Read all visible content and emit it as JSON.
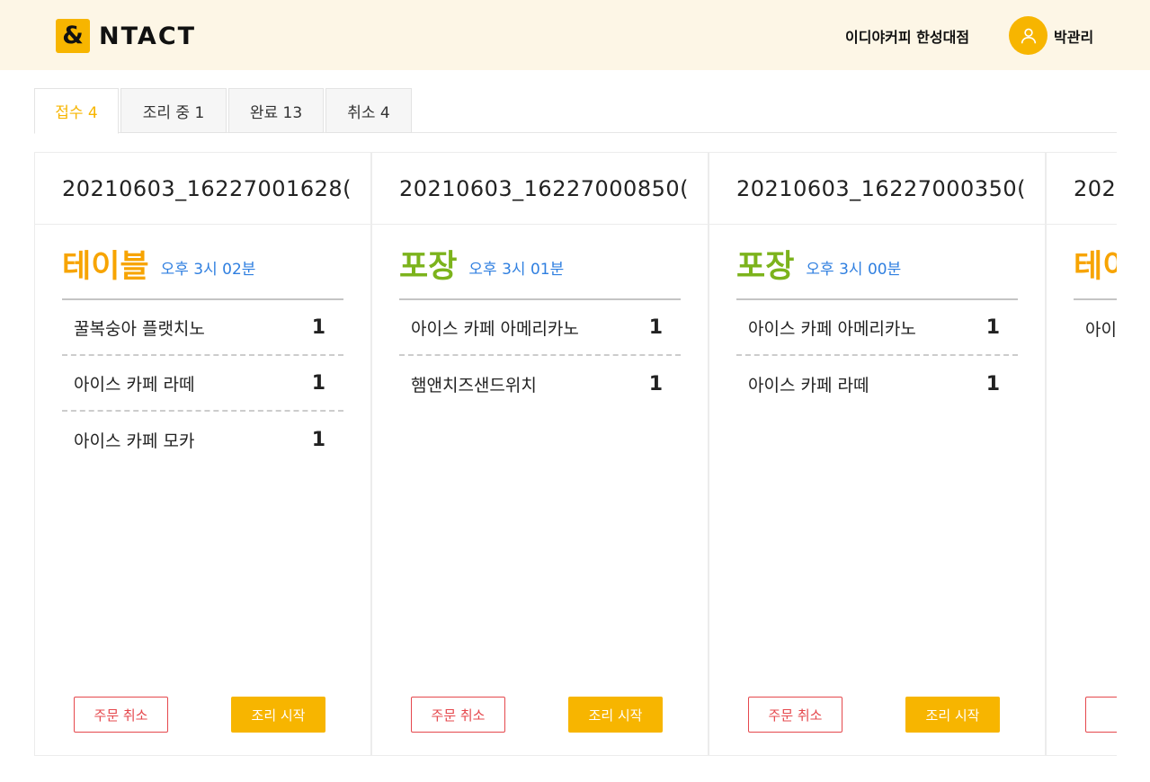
{
  "header": {
    "logo_mark": "&",
    "logo_text": "NTACT",
    "store_name": "이디야커피 한성대점",
    "user_name": "박관리",
    "brand_color": "#f7b500"
  },
  "tabs": [
    {
      "label": "접수 4",
      "active": true
    },
    {
      "label": "조리 중 1",
      "active": false
    },
    {
      "label": "완료 13",
      "active": false
    },
    {
      "label": "취소 4",
      "active": false
    }
  ],
  "orders": [
    {
      "order_no": "20210603_16227001628(",
      "type": "테이블",
      "type_color": "#f7a400",
      "time": "오후 3시 02분",
      "items": [
        {
          "name": "꿀복숭아 플랫치노",
          "qty": "1"
        },
        {
          "name": "아이스 카페 라떼",
          "qty": "1"
        },
        {
          "name": "아이스 카페 모카",
          "qty": "1"
        }
      ],
      "cancel_label": "주문 취소",
      "start_label": "조리 시작"
    },
    {
      "order_no": "20210603_16227000850(",
      "type": "포장",
      "type_color": "#7cb31c",
      "time": "오후 3시 01분",
      "items": [
        {
          "name": "아이스 카페 아메리카노",
          "qty": "1"
        },
        {
          "name": "햄앤치즈샌드위치",
          "qty": "1"
        }
      ],
      "cancel_label": "주문 취소",
      "start_label": "조리 시작"
    },
    {
      "order_no": "20210603_16227000350(",
      "type": "포장",
      "type_color": "#7cb31c",
      "time": "오후 3시 00분",
      "items": [
        {
          "name": "아이스 카페 아메리카노",
          "qty": "1"
        },
        {
          "name": "아이스 카페 라떼",
          "qty": "1"
        }
      ],
      "cancel_label": "주문 취소",
      "start_label": "조리 시작"
    },
    {
      "order_no": "202",
      "type": "테이",
      "type_color": "#f7a400",
      "time": "",
      "items": [
        {
          "name": "아이",
          "qty": ""
        }
      ],
      "cancel_label": "주",
      "start_label": ""
    }
  ]
}
